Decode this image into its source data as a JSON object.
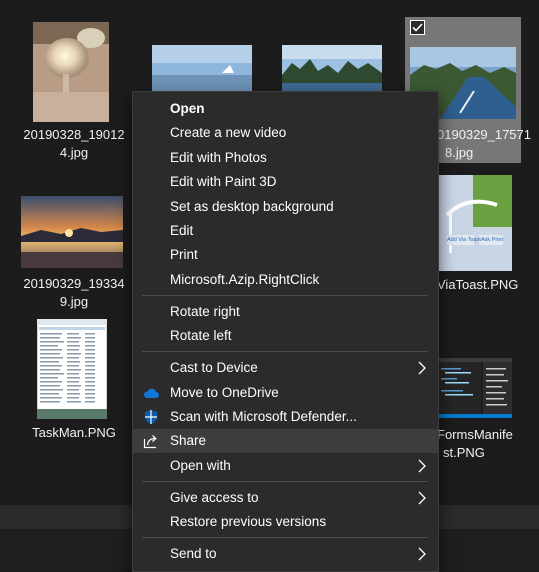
{
  "files": [
    {
      "name": "20190328_190124.jpg",
      "line1": "20190328_19012",
      "line2": "4.jpg"
    },
    {
      "name": "20190329_175718.jpg",
      "line1": "0190329_17571",
      "line2": "8.jpg"
    },
    {
      "name": "20190329_193349.jpg",
      "line1": "20190329_19334",
      "line2": "9.jpg"
    },
    {
      "name": "ViaToast.PNG",
      "line1": "ViaToast.PNG"
    },
    {
      "name": "TaskMan.PNG",
      "line1": "TaskMan.PNG"
    },
    {
      "name": "FormsManifest.PNG",
      "line1": "FormsManife",
      "line2": "st.PNG"
    }
  ],
  "thumb_text": {
    "via_toast": "Add Via Toast",
    "ask_print": "Ask Print"
  },
  "context_menu": {
    "open": "Open",
    "create_video": "Create a new video",
    "edit_photos": "Edit with Photos",
    "edit_paint3d": "Edit with Paint 3D",
    "set_background": "Set as desktop background",
    "edit": "Edit",
    "print": "Print",
    "azip": "Microsoft.Azip.RightClick",
    "rotate_right": "Rotate right",
    "rotate_left": "Rotate left",
    "cast": "Cast to Device",
    "onedrive": "Move to OneDrive",
    "defender": "Scan with Microsoft Defender...",
    "share": "Share",
    "open_with": "Open with",
    "give_access": "Give access to",
    "restore": "Restore previous versions",
    "send_to": "Send to"
  },
  "icons": {
    "onedrive": "cloud-icon",
    "defender": "shield-icon",
    "share": "share-icon",
    "submenu": "chevron-right-icon",
    "checkbox": "checkmark-icon"
  },
  "colors": {
    "background": "#1c1c1c",
    "menu_background": "#2b2b2b",
    "menu_hover": "#3d3d3d",
    "selected_item": "#777777",
    "onedrive_blue": "#0f78d4",
    "defender_blue": "#0b5cad"
  }
}
